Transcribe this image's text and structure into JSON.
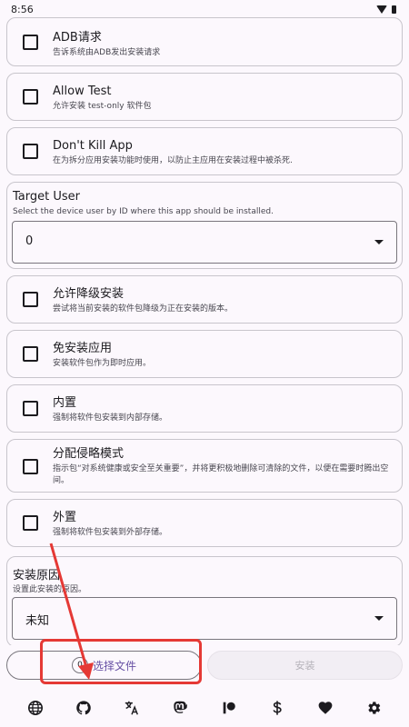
{
  "status_bar": {
    "time": "8:56"
  },
  "options": [
    {
      "title": "ADB请求",
      "desc": "告诉系统由ADB发出安装请求"
    },
    {
      "title": "Allow Test",
      "desc": "允许安装 test-only 软件包"
    },
    {
      "title": "Don't Kill App",
      "desc": "在为拆分应用安装功能时使用，以防止主应用在安装过程中被杀死."
    }
  ],
  "target_user": {
    "title": "Target User",
    "desc": "Select the device user by ID where this app should be installed.",
    "value": "0"
  },
  "options2": [
    {
      "title": "允许降级安装",
      "desc": "尝试将当前安装的软件包降级为正在安装的版本。"
    },
    {
      "title": "免安装应用",
      "desc": "安装软件包作为即时应用。"
    },
    {
      "title": "内置",
      "desc": "强制将软件包安装到内部存储。"
    },
    {
      "title": "分配侵略模式",
      "desc": "指示包“对系统健康或安全至关重要”，并将更积极地删除可清除的文件，以便在需要时腾出空间。"
    },
    {
      "title": "外置",
      "desc": "强制将软件包安装到外部存储。"
    }
  ],
  "install_reason": {
    "title": "安装原因",
    "desc": "设置此安装的原因。",
    "value": "未知"
  },
  "actions": {
    "file_count": "0",
    "select_label": "选择文件",
    "install_label": "安装"
  },
  "bottom_nav": [
    "globe-icon",
    "github-icon",
    "translate-icon",
    "mastodon-icon",
    "patreon-icon",
    "dollar-icon",
    "heart-icon",
    "gear-icon"
  ],
  "colors": {
    "accent": "#6750a4",
    "annotation": "#e53935"
  }
}
